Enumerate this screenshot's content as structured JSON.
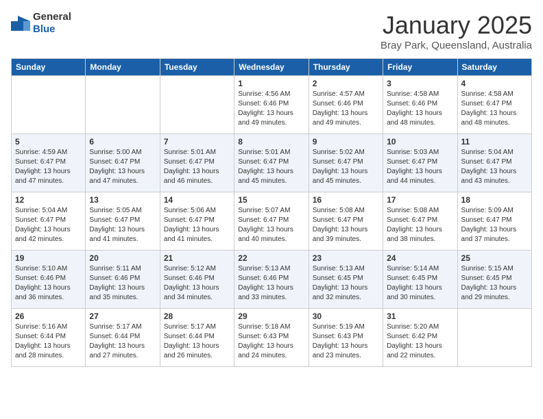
{
  "header": {
    "logo_general": "General",
    "logo_blue": "Blue",
    "month": "January 2025",
    "location": "Bray Park, Queensland, Australia"
  },
  "days_of_week": [
    "Sunday",
    "Monday",
    "Tuesday",
    "Wednesday",
    "Thursday",
    "Friday",
    "Saturday"
  ],
  "weeks": [
    [
      {
        "day": "",
        "detail": ""
      },
      {
        "day": "",
        "detail": ""
      },
      {
        "day": "",
        "detail": ""
      },
      {
        "day": "1",
        "detail": "Sunrise: 4:56 AM\nSunset: 6:46 PM\nDaylight: 13 hours\nand 49 minutes."
      },
      {
        "day": "2",
        "detail": "Sunrise: 4:57 AM\nSunset: 6:46 PM\nDaylight: 13 hours\nand 49 minutes."
      },
      {
        "day": "3",
        "detail": "Sunrise: 4:58 AM\nSunset: 6:46 PM\nDaylight: 13 hours\nand 48 minutes."
      },
      {
        "day": "4",
        "detail": "Sunrise: 4:58 AM\nSunset: 6:47 PM\nDaylight: 13 hours\nand 48 minutes."
      }
    ],
    [
      {
        "day": "5",
        "detail": "Sunrise: 4:59 AM\nSunset: 6:47 PM\nDaylight: 13 hours\nand 47 minutes."
      },
      {
        "day": "6",
        "detail": "Sunrise: 5:00 AM\nSunset: 6:47 PM\nDaylight: 13 hours\nand 47 minutes."
      },
      {
        "day": "7",
        "detail": "Sunrise: 5:01 AM\nSunset: 6:47 PM\nDaylight: 13 hours\nand 46 minutes."
      },
      {
        "day": "8",
        "detail": "Sunrise: 5:01 AM\nSunset: 6:47 PM\nDaylight: 13 hours\nand 45 minutes."
      },
      {
        "day": "9",
        "detail": "Sunrise: 5:02 AM\nSunset: 6:47 PM\nDaylight: 13 hours\nand 45 minutes."
      },
      {
        "day": "10",
        "detail": "Sunrise: 5:03 AM\nSunset: 6:47 PM\nDaylight: 13 hours\nand 44 minutes."
      },
      {
        "day": "11",
        "detail": "Sunrise: 5:04 AM\nSunset: 6:47 PM\nDaylight: 13 hours\nand 43 minutes."
      }
    ],
    [
      {
        "day": "12",
        "detail": "Sunrise: 5:04 AM\nSunset: 6:47 PM\nDaylight: 13 hours\nand 42 minutes."
      },
      {
        "day": "13",
        "detail": "Sunrise: 5:05 AM\nSunset: 6:47 PM\nDaylight: 13 hours\nand 41 minutes."
      },
      {
        "day": "14",
        "detail": "Sunrise: 5:06 AM\nSunset: 6:47 PM\nDaylight: 13 hours\nand 41 minutes."
      },
      {
        "day": "15",
        "detail": "Sunrise: 5:07 AM\nSunset: 6:47 PM\nDaylight: 13 hours\nand 40 minutes."
      },
      {
        "day": "16",
        "detail": "Sunrise: 5:08 AM\nSunset: 6:47 PM\nDaylight: 13 hours\nand 39 minutes."
      },
      {
        "day": "17",
        "detail": "Sunrise: 5:08 AM\nSunset: 6:47 PM\nDaylight: 13 hours\nand 38 minutes."
      },
      {
        "day": "18",
        "detail": "Sunrise: 5:09 AM\nSunset: 6:47 PM\nDaylight: 13 hours\nand 37 minutes."
      }
    ],
    [
      {
        "day": "19",
        "detail": "Sunrise: 5:10 AM\nSunset: 6:46 PM\nDaylight: 13 hours\nand 36 minutes."
      },
      {
        "day": "20",
        "detail": "Sunrise: 5:11 AM\nSunset: 6:46 PM\nDaylight: 13 hours\nand 35 minutes."
      },
      {
        "day": "21",
        "detail": "Sunrise: 5:12 AM\nSunset: 6:46 PM\nDaylight: 13 hours\nand 34 minutes."
      },
      {
        "day": "22",
        "detail": "Sunrise: 5:13 AM\nSunset: 6:46 PM\nDaylight: 13 hours\nand 33 minutes."
      },
      {
        "day": "23",
        "detail": "Sunrise: 5:13 AM\nSunset: 6:45 PM\nDaylight: 13 hours\nand 32 minutes."
      },
      {
        "day": "24",
        "detail": "Sunrise: 5:14 AM\nSunset: 6:45 PM\nDaylight: 13 hours\nand 30 minutes."
      },
      {
        "day": "25",
        "detail": "Sunrise: 5:15 AM\nSunset: 6:45 PM\nDaylight: 13 hours\nand 29 minutes."
      }
    ],
    [
      {
        "day": "26",
        "detail": "Sunrise: 5:16 AM\nSunset: 6:44 PM\nDaylight: 13 hours\nand 28 minutes."
      },
      {
        "day": "27",
        "detail": "Sunrise: 5:17 AM\nSunset: 6:44 PM\nDaylight: 13 hours\nand 27 minutes."
      },
      {
        "day": "28",
        "detail": "Sunrise: 5:17 AM\nSunset: 6:44 PM\nDaylight: 13 hours\nand 26 minutes."
      },
      {
        "day": "29",
        "detail": "Sunrise: 5:18 AM\nSunset: 6:43 PM\nDaylight: 13 hours\nand 24 minutes."
      },
      {
        "day": "30",
        "detail": "Sunrise: 5:19 AM\nSunset: 6:43 PM\nDaylight: 13 hours\nand 23 minutes."
      },
      {
        "day": "31",
        "detail": "Sunrise: 5:20 AM\nSunset: 6:42 PM\nDaylight: 13 hours\nand 22 minutes."
      },
      {
        "day": "",
        "detail": ""
      }
    ]
  ]
}
